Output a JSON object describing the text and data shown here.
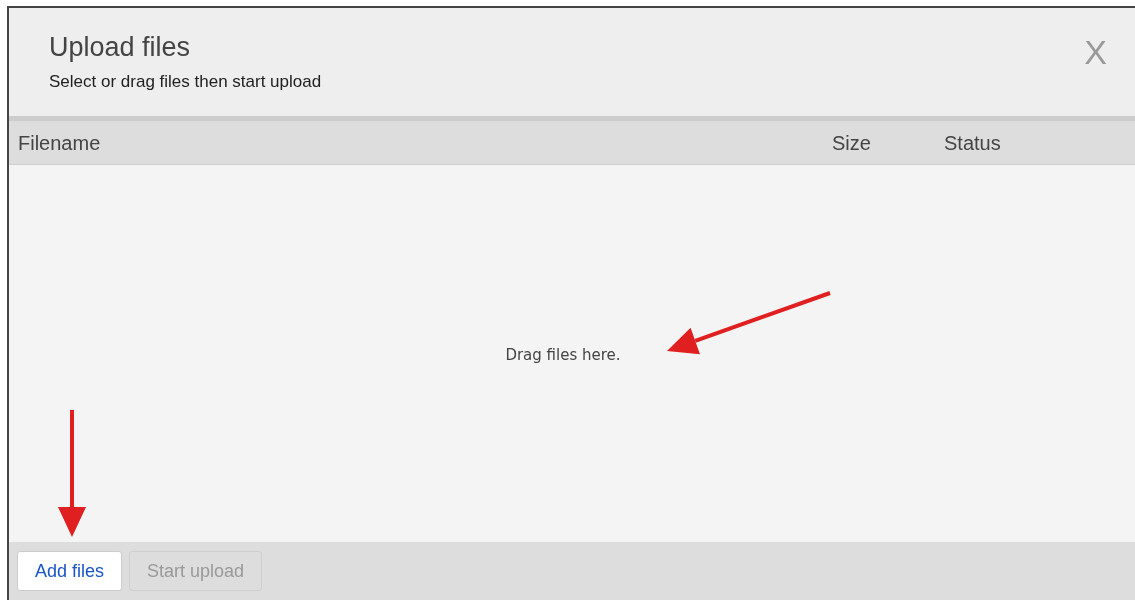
{
  "dialog": {
    "title": "Upload files",
    "subtitle": "Select or drag files then start upload",
    "close": "X"
  },
  "table": {
    "columns": [
      "Filename",
      "Size",
      "Status"
    ],
    "empty_message": "Drag files here."
  },
  "buttons": [
    {
      "label": "Add files",
      "disabled": false
    },
    {
      "label": "Start upload",
      "disabled": true
    }
  ]
}
